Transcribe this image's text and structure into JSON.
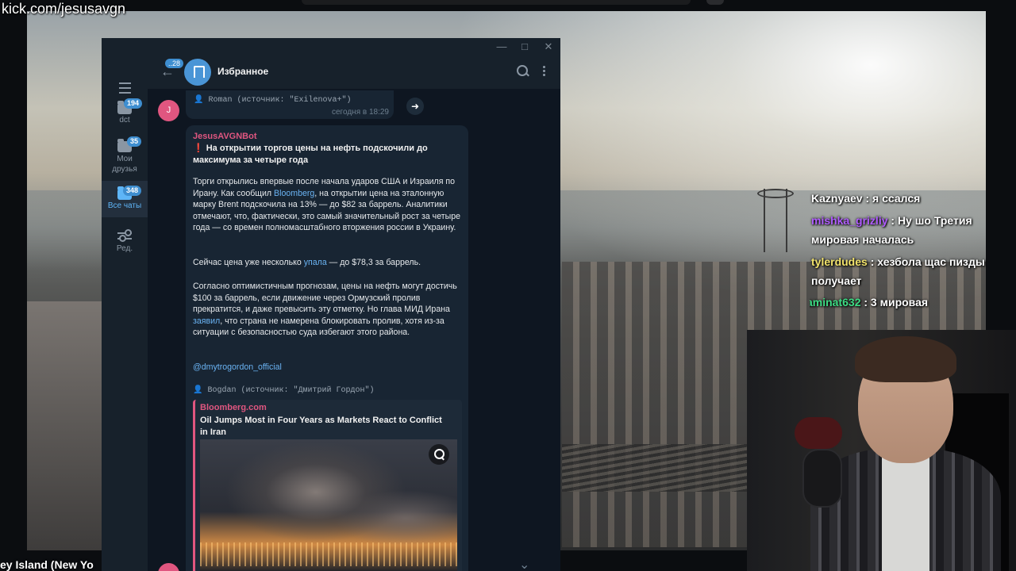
{
  "stream": {
    "watermark": "kick.com/jesusavgn",
    "location_caption": "ey Island (New Yo"
  },
  "telegram": {
    "window_controls": {
      "minimize": "—",
      "maximize": "□",
      "close": "✕"
    },
    "sidebar": {
      "folders": [
        {
          "label": "dct",
          "badge": "194",
          "icon": "folder-icon"
        },
        {
          "label": "Мои\nдрузья",
          "badge": "35",
          "icon": "folder-icon"
        },
        {
          "label": "Все чаты",
          "badge": "348",
          "icon": "chat-bubbles-icon",
          "active": true
        },
        {
          "label": "Ред.",
          "icon": "sliders-icon"
        }
      ]
    },
    "header": {
      "back_badge": "..28",
      "title": "Избранное"
    },
    "messages": {
      "sender_initial": "J",
      "forward_top": "Roman (источник: \"Exilenova+\")",
      "forward_top_time": "сегодня в 18:29",
      "sender": "JesusAVGNBot",
      "headline": "На открытии торгов цены на нефть подскочили до максимума за четыре года",
      "p1_a": "Торги открылись впервые после начала ударов США и Израиля по Ирану. Как сообщил ",
      "p1_link": "Bloomberg",
      "p1_b": ", на открытии цена на эталонную марку Brent подскочила на 13% — до $82 за баррель. Аналитики отмечают, что, фактически, это самый значительный рост за четыре года — со времен полномасштабного вторжения россии в Украину.",
      "p2_a": "Сейчас цена уже несколько ",
      "p2_link": "упала",
      "p2_b": " — до $78,3 за баррель.",
      "p3_a": "Согласно оптимистичным прогнозам, цены на нефть могут достичь $100 за баррель, если движение через Ормузский пролив прекратится, и даже превысить эту отметку. Но глава МИД Ирана ",
      "p3_link": "заявил",
      "p3_b": ", что страна не намерена блокировать пролив, хотя из-за ситуации с безопасностью суда избегают этого района.",
      "signature": "@dmytrogordon_official",
      "forward2": "Bogdan (источник: \"Дмитрий Гордон\")",
      "preview_site": "Bloomberg.com",
      "preview_title": "Oil Jumps Most in Four Years as Markets React to Conflict in Iran"
    }
  },
  "stream_chat": [
    {
      "user": "Kaznyaev",
      "text": ": я ссался",
      "color": "#e8e8e8"
    },
    {
      "user": "mishka_grizliy",
      "text": ": Ну шо Третия мировая началась",
      "color": "#b05cff"
    },
    {
      "user": "tylerdudes",
      "text": ": хезбола щас пизды получает",
      "color": "#f2e36b"
    },
    {
      "user": "aminat632",
      "text": ": 3 мировая",
      "color": "#3ddc84"
    }
  ]
}
